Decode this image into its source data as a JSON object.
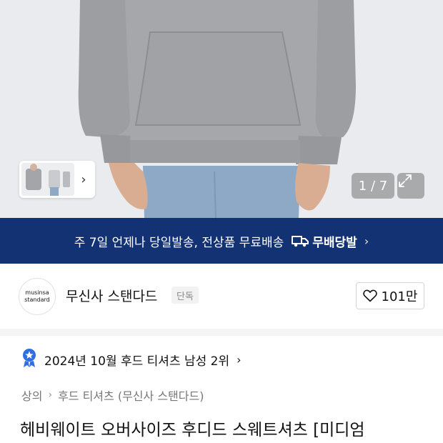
{
  "gallery": {
    "counter": "1 / 7",
    "thumb_next_icon": "chevron-right-icon",
    "expand_icon": "expand-icon"
  },
  "shipping_banner": {
    "text": "주 7일 언제나 당일발송, 전상품 무료배송",
    "logo_text": "무배당발",
    "chevron": "›"
  },
  "brand": {
    "logo_line1": "musinsa",
    "logo_line2": "standard",
    "name": "무신사 스탠다드",
    "badge": "단독",
    "likes": "101만"
  },
  "ranking": {
    "text": "2024년 10월 후드 티셔츠 남성 2위",
    "chevron": "›"
  },
  "breadcrumb": {
    "items": [
      "상의",
      "후드 티셔츠 (무신사 스탠다드)"
    ],
    "separator": "›"
  },
  "product": {
    "title": "헤비웨이트 오버사이즈 후디드 스웨트셔츠 [미디엄"
  },
  "colors": {
    "banner": "#123274",
    "medal": "#2f6fe0"
  }
}
